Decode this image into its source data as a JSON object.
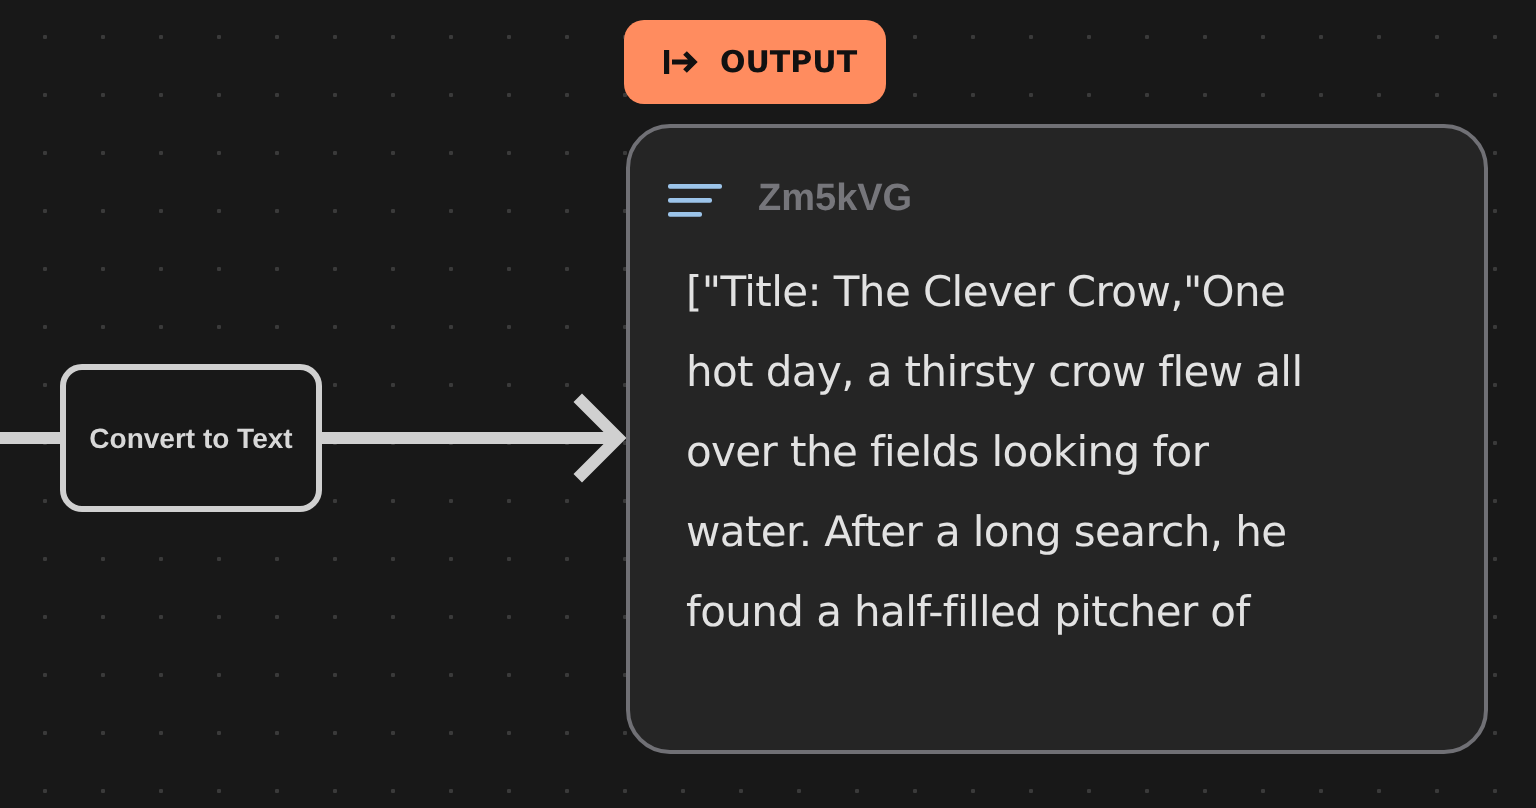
{
  "output_badge": {
    "label": "OUTPUT"
  },
  "process_node": {
    "label": "Convert to Text"
  },
  "output_node": {
    "title": "Zm5kVG",
    "lines": [
      "[\"Title: The Clever Crow,\"One",
      "hot day, a thirsty crow flew all",
      "over the fields looking for",
      "water. After a long search, he",
      "found a half-filled pitcher of"
    ]
  }
}
